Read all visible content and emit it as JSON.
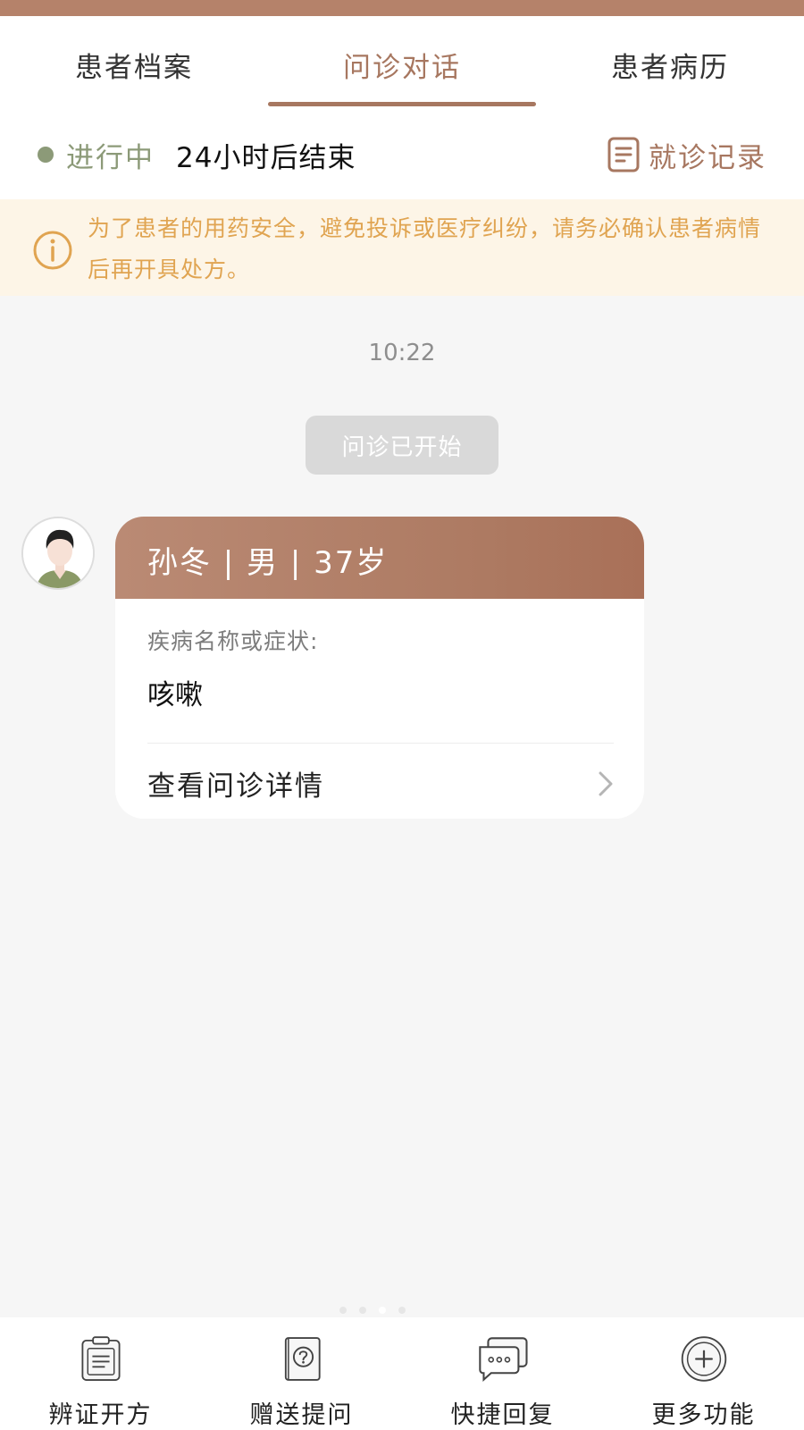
{
  "tabs": [
    {
      "label": "患者档案"
    },
    {
      "label": "问诊对话"
    },
    {
      "label": "患者病历"
    }
  ],
  "status": {
    "label": "进行中",
    "remaining": "24小时后结束",
    "record_label": "就诊记录"
  },
  "notice": {
    "text": "为了患者的用药安全，避免投诉或医疗纠纷，请务必确认患者病情后再开具处方。"
  },
  "chat": {
    "time": "10:22",
    "system_message": "问诊已开始",
    "card": {
      "header": "孙冬 | 男 | 37岁",
      "symptom_label": "疾病名称或症状:",
      "symptom_value": "咳嗽",
      "details_link": "查看问诊详情"
    }
  },
  "bottom_bar": {
    "items": [
      {
        "label": "辨证开方",
        "icon": "prescription-clipboard-icon"
      },
      {
        "label": "赠送提问",
        "icon": "question-book-icon"
      },
      {
        "label": "快捷回复",
        "icon": "chat-bubbles-icon"
      },
      {
        "label": "更多功能",
        "icon": "plus-circle-icon"
      }
    ]
  },
  "colors": {
    "accent": "#a77760",
    "status_green": "#8c9a78",
    "notice_text": "#e0a451",
    "notice_bg": "#fdf5e7"
  }
}
